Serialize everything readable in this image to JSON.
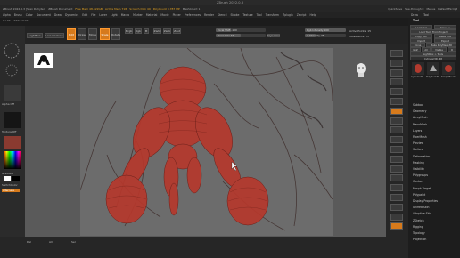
{
  "window": {
    "title": "ZBrush 2022.0.3"
  },
  "infobar": {
    "items": [
      "ZBrush 2022.0.3 [Stan Dehyter]",
      "ZBrush Document",
      "Free Mem 48.422GB",
      "Active Mem 718",
      "Scratch Disk 49",
      "PolyCount 9.787 MP",
      "MeshCount 1"
    ],
    "quicksave": "QuickSave",
    "see_through": "See-through 0",
    "menus": "Menus",
    "default_script": "DefaultZScript"
  },
  "menubar": {
    "items": [
      "Alpha",
      "Brush",
      "Color",
      "Document",
      "Draw",
      "Dynamics",
      "Edit",
      "File",
      "Layer",
      "Light",
      "Macro",
      "Marker",
      "Material",
      "Movie",
      "Picker",
      "Preferences",
      "Render",
      "Stencil",
      "Stroke",
      "Texture",
      "Tool",
      "Transform",
      "Zplugin",
      "Zscript",
      "Help"
    ]
  },
  "rightmenu": {
    "items": [
      "Draw",
      "Tool"
    ]
  },
  "status": {
    "text": "6.769 Y 4997 -0.017"
  },
  "shelf": {
    "home_page": "Home Page",
    "lightbox": "LightBox",
    "live_boolean": "Live Boolean",
    "edit": "Edit",
    "draw": "Draw",
    "move": "Move",
    "scale": "Scale",
    "rotate": "Rotate",
    "mrgb": "Mrgb",
    "rgb": "Rgb",
    "m": "M",
    "zadd": "Zadd",
    "zsub": "Zsub",
    "zcut": "Zcut",
    "focal_shift": "Focal Shift -100",
    "draw_size": "Draw Size 64",
    "rgb_intensity": "Rgb Intensity 100",
    "z_intensity": "Z Intensity 25",
    "dynamic": "Dynamic",
    "active_points": "ActivePoints: 15",
    "total_points": "TotalPoints: 15"
  },
  "left_panel": {
    "labels": [
      "Alpha Off",
      "Texture Off",
      "Gradient",
      "SwitchColor",
      "Alternate"
    ]
  },
  "bottom_bar": {
    "items": [
      "Del",
      "All",
      "Sel"
    ]
  },
  "right_panel": {
    "tool_buttons": [
      "Load Tool",
      "Save As",
      "Load Tools From Project",
      "Copy Tool",
      "Paste Tool",
      "Import",
      "Export",
      "Clone",
      "Make PolyMesh3D",
      "GoZ",
      "All",
      "Visible",
      "R",
      "Lightbox > Tools"
    ],
    "current_tool": "Cylinder3D. 48",
    "subtools": [
      "Cylinder3D",
      "PolyMesh3D",
      "SimpleBrush"
    ],
    "sections": [
      "Subtool",
      "Geometry",
      "ArrayMesh",
      "NanoMesh",
      "Layers",
      "FiberMesh",
      "Preview",
      "Surface",
      "Deformation",
      "Masking",
      "Visibility",
      "Polygroups",
      "Contact",
      "Morph Target",
      "Polypaint",
      "UV Map",
      "Texture Map",
      "Displacement Map",
      "Normal Map",
      "Vector Displacement Map",
      "Display Properties",
      "Unified Skin",
      "Initialize",
      "Import",
      "Export"
    ],
    "sections_visible": [
      "Subtool",
      "Geometry",
      "ArrayMesh",
      "NanoMesh",
      "Layers",
      "FiberMesh",
      "Preview",
      "Surface",
      "Deformation",
      "Masking",
      "Visibility",
      "Polygroups",
      "Contact",
      "Morph Target",
      "Polypaint",
      "Display Properties",
      "Unified Skin",
      "Adaptive Skin",
      "ZSketch",
      "Rigging",
      "Topology",
      "Projection"
    ]
  },
  "colors": {
    "accent": "#d67a1c",
    "model": "#b23a2e",
    "canvas": "#6c6c6c",
    "viewport": "#5a5a5a"
  }
}
